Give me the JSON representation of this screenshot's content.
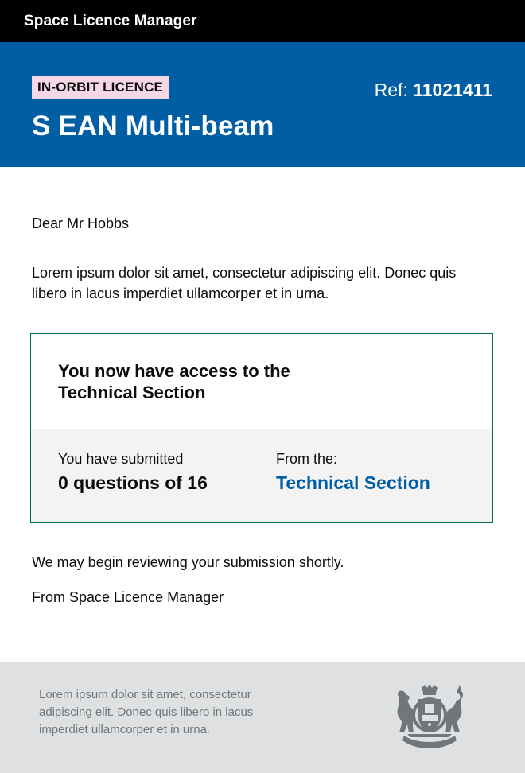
{
  "app": {
    "title": "Space Licence Manager"
  },
  "hero": {
    "tag": "IN-ORBIT LICENCE",
    "ref_label": "Ref:",
    "ref_number": "11021411",
    "title": "S EAN Multi-beam"
  },
  "letter": {
    "greeting": "Dear Mr Hobbs",
    "intro": "Lorem ipsum dolor sit amet, consectetur adipiscing elit. Donec quis libero in lacus imperdiet ullamcorper et in urna.",
    "panel": {
      "heading": "You now have access to the Technical Section",
      "submitted_label": "You have submitted",
      "submitted_value": "0 questions of 16",
      "from_label": "From the:",
      "from_value": "Technical Section"
    },
    "review_note": "We may begin reviewing your submission shortly.",
    "signoff": "From Space Licence Manager"
  },
  "footer": {
    "text": "Lorem ipsum dolor sit amet, consectetur adipiscing elit. Donec quis libero in lacus imperdiet ullamcorper et in urna.",
    "crest_icon": "royal-coat-of-arms-icon"
  },
  "colors": {
    "topbar": "#000000",
    "hero": "#005ea5",
    "tag": "#f6d7e6",
    "panel_border": "#00703c",
    "link": "#005ea5",
    "footer": "#dee0e2"
  }
}
